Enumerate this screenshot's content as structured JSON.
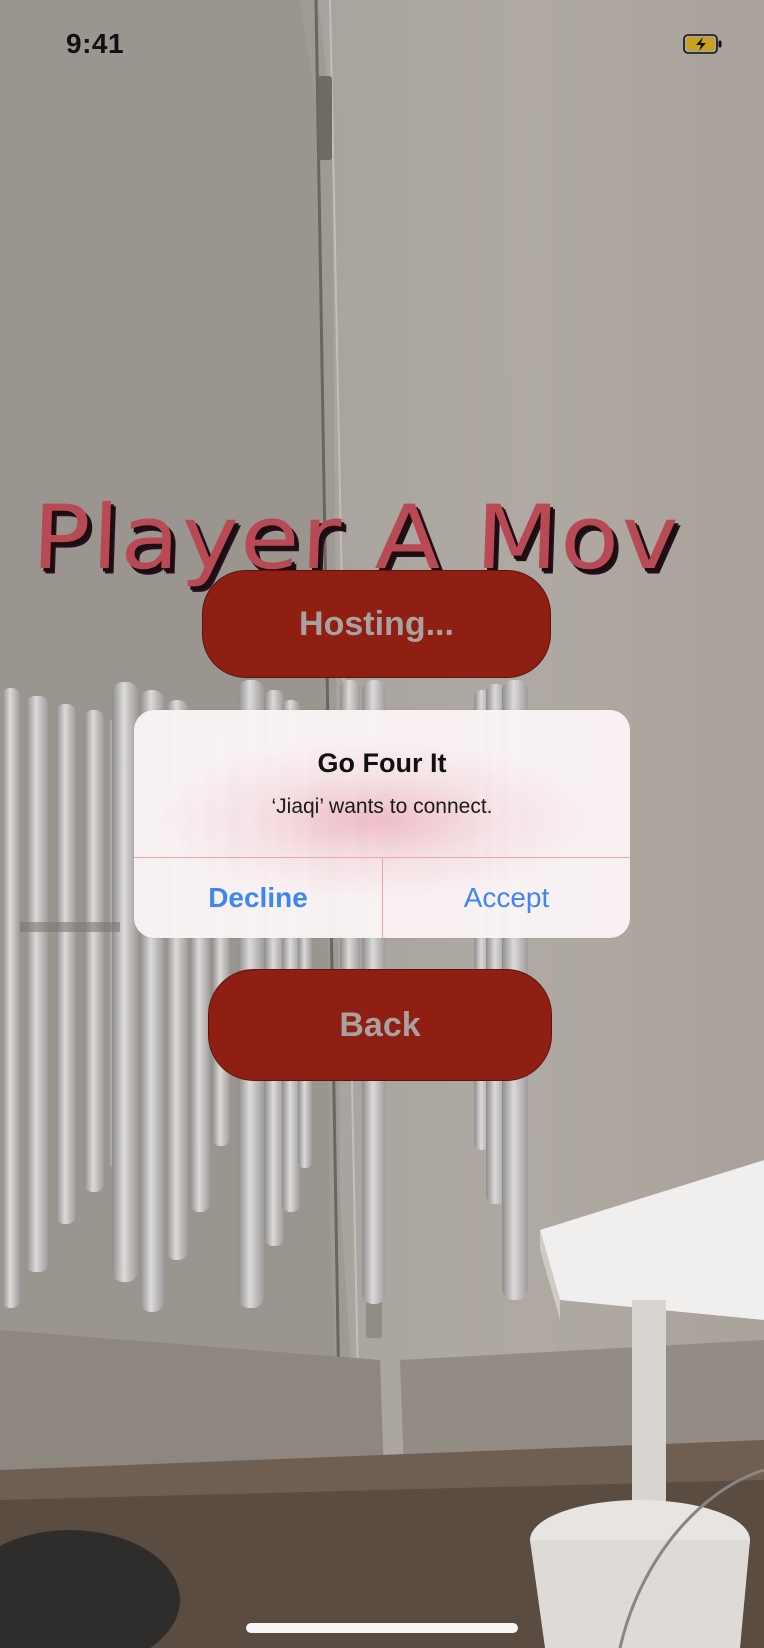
{
  "status_bar": {
    "time": "9:41",
    "battery_icon": "battery-charging-icon"
  },
  "ar_scene": {
    "banner_text": "Player A Mov",
    "banner_color": "#b84a55"
  },
  "buttons": {
    "hosting_label": "Hosting...",
    "back_label": "Back",
    "button_color": "#8f1f12",
    "label_color": "#a9a1a0"
  },
  "alert": {
    "title": "Go Four It",
    "message": "‘Jiaqi’ wants to connect.",
    "decline_label": "Decline",
    "accept_label": "Accept",
    "action_color": "#3f86ee"
  }
}
